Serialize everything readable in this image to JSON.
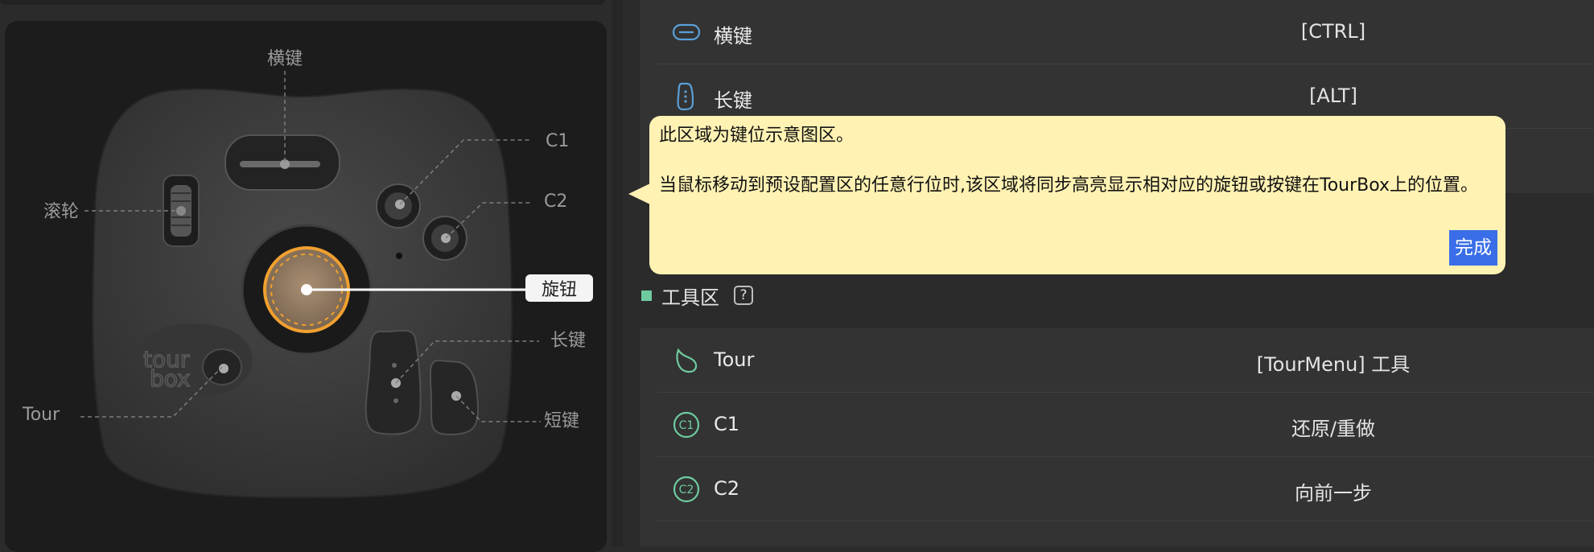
{
  "device": {
    "callouts": {
      "side_button": "横键",
      "c1": "C1",
      "c2": "C2",
      "scroll": "滚轮",
      "knob": "旋钮",
      "tall_button": "长键",
      "short_button": "短键",
      "tour": "Tour"
    },
    "knob_color": "#f0a030"
  },
  "button_config": {
    "rows": [
      {
        "label": "横键",
        "value": "[CTRL]",
        "icon": "side-button-icon"
      },
      {
        "label": "长键",
        "value": "[ALT]",
        "icon": "tall-button-icon"
      }
    ]
  },
  "tools": {
    "title": "工具区",
    "help": "?",
    "rows": [
      {
        "label": "Tour",
        "value": "[TourMenu] 工具",
        "icon": "tour-icon"
      },
      {
        "label": "C1",
        "value": "还原/重做",
        "icon": "c1-icon"
      },
      {
        "label": "C2",
        "value": "向前一步",
        "icon": "c2-icon"
      }
    ],
    "icon_glyphs": {
      "c1": "C1",
      "c2": "C2"
    }
  },
  "tooltip": {
    "title": "此区域为键位示意图区。",
    "body": "当鼠标移动到预设配置区的任意行位时,该区域将同步高亮显示相对应的旋钮或按键在TourBox上的位置。",
    "done": "完成"
  },
  "colors": {
    "accent_green": "#6ecb9f",
    "accent_blue": "#5aa0d8",
    "tooltip_bg": "#fff2b3",
    "done_button": "#3a6ee8"
  }
}
